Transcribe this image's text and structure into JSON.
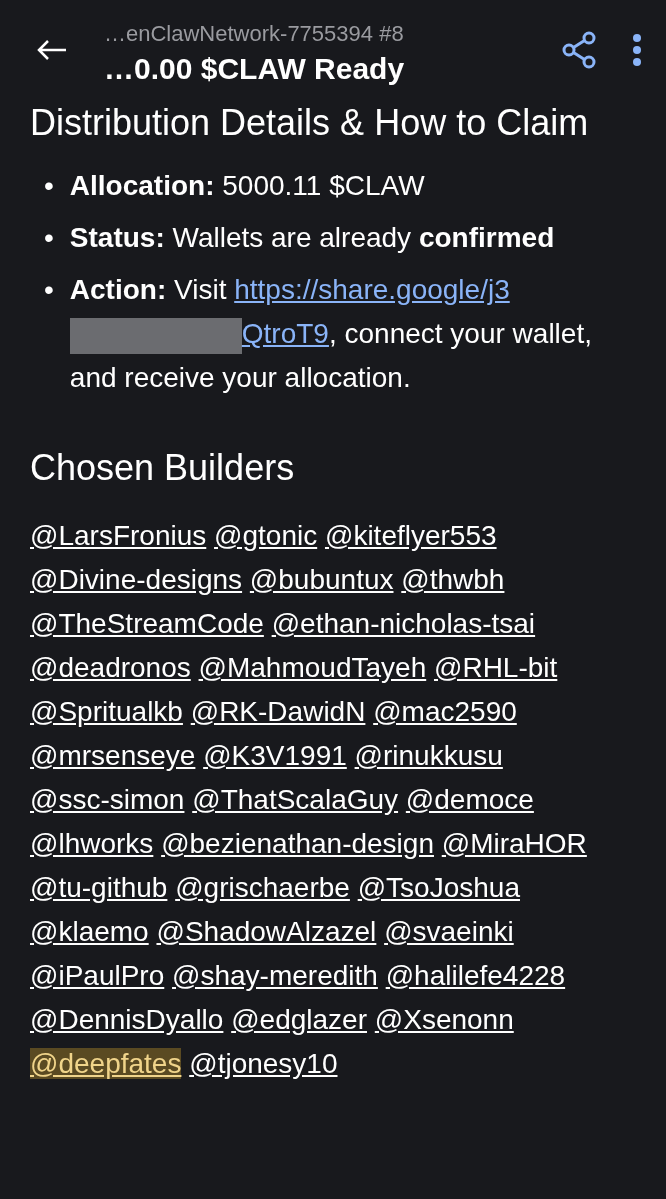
{
  "header": {
    "subtitle": "…enClawNetwork-7755394 #8",
    "title": "…0.00 $CLAW Ready"
  },
  "section_title": "Distribution Details & How to Claim",
  "details": [
    {
      "kind": "text",
      "marker": "•",
      "label": "Allocation:",
      "text": "5000.11 $CLAW"
    },
    {
      "kind": "text",
      "marker": "•",
      "label": "Status:",
      "text": "Wallets are already **confirmed**"
    },
    {
      "kind": "link",
      "marker": "•",
      "label": "Action:",
      "text": "Visit",
      "link_start": "https://share.google/j3",
      "link_end": "QtroT9",
      "redacted": true,
      "after": ", connect your wallet, and receive your allocation."
    }
  ],
  "builders_title": "Chosen Builders",
  "builders": [
    {
      "handle": "@LarsFronius",
      "highlighted": false
    },
    {
      "handle": "@gtonic",
      "highlighted": false
    },
    {
      "handle": "@kiteflyer553",
      "highlighted": false
    },
    {
      "handle": "@Divine-designs",
      "highlighted": false
    },
    {
      "handle": "@bubuntux",
      "highlighted": false
    },
    {
      "handle": "@thwbh",
      "highlighted": false
    },
    {
      "handle": "@TheStreamCode",
      "highlighted": false
    },
    {
      "handle": "@ethan-nicholas-tsai",
      "highlighted": false
    },
    {
      "handle": "@deadronos",
      "highlighted": false
    },
    {
      "handle": "@MahmoudTayeh",
      "highlighted": false
    },
    {
      "handle": "@RHL-bit",
      "highlighted": false
    },
    {
      "handle": "@Spritualkb",
      "highlighted": false
    },
    {
      "handle": "@RK-DawidN",
      "highlighted": false
    },
    {
      "handle": "@mac2590",
      "highlighted": false
    },
    {
      "handle": "@mrsenseye",
      "highlighted": false
    },
    {
      "handle": "@K3V1991",
      "highlighted": false
    },
    {
      "handle": "@rinukkusu",
      "highlighted": false
    },
    {
      "handle": "@ssc-simon",
      "highlighted": false
    },
    {
      "handle": "@ThatScalaGuy",
      "highlighted": false
    },
    {
      "handle": "@democe",
      "highlighted": false
    },
    {
      "handle": "@lhworks",
      "highlighted": false
    },
    {
      "handle": "@bezienathan-design",
      "highlighted": false
    },
    {
      "handle": "@MiraHOR",
      "highlighted": false
    },
    {
      "handle": "@tu-github",
      "highlighted": false
    },
    {
      "handle": "@grischaerbe",
      "highlighted": false
    },
    {
      "handle": "@TsoJoshua",
      "highlighted": false
    },
    {
      "handle": "@klaemo",
      "highlighted": false
    },
    {
      "handle": "@ShadowAlzazel",
      "highlighted": false
    },
    {
      "handle": "@svaeinki",
      "highlighted": false
    },
    {
      "handle": "@iPaulPro",
      "highlighted": false
    },
    {
      "handle": "@shay-meredith",
      "highlighted": false
    },
    {
      "handle": "@halilefe4228",
      "highlighted": false
    },
    {
      "handle": "@DennisDyallo",
      "highlighted": false
    },
    {
      "handle": "@edglazer",
      "highlighted": false
    },
    {
      "handle": "@Xsenonn",
      "highlighted": false
    },
    {
      "handle": "@deepfates",
      "highlighted": true
    },
    {
      "handle": "@tjonesy10",
      "highlighted": false
    }
  ]
}
